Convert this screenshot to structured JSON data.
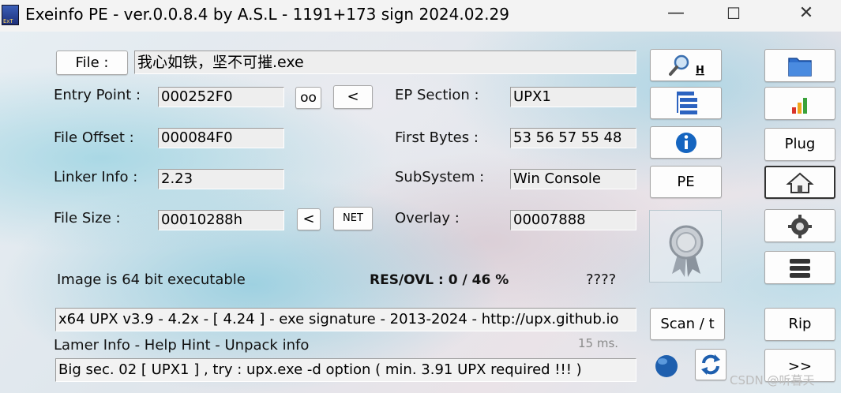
{
  "titlebar": {
    "title": "Exeinfo PE - ver.0.0.8.4  by A.S.L -  1191+173 sign  2024.02.29",
    "minimize_glyph": "—",
    "maximize_glyph": "☐",
    "close_glyph": "✕"
  },
  "file": {
    "button_label": "File :",
    "name": "我心如铁，坚不可摧.exe"
  },
  "fields": {
    "entry_point_label": "Entry Point :",
    "entry_point_value": "000252F0",
    "file_offset_label": "File Offset :",
    "file_offset_value": "000084F0",
    "linker_info_label": "Linker Info :",
    "linker_info_value": "2.23",
    "file_size_label": "File Size :",
    "file_size_value": "00010288h",
    "ep_section_label": "EP Section :",
    "ep_section_value": "UPX1",
    "first_bytes_label": "First Bytes :",
    "first_bytes_value": "53 56 57 55 48",
    "subsystem_label": "SubSystem :",
    "subsystem_value": "Win Console",
    "overlay_label": "Overlay :",
    "overlay_value": "00007888"
  },
  "small_buttons": {
    "oo": "oo",
    "lt1": "<",
    "lt2": "<",
    "net": "NET"
  },
  "status": {
    "bits": "Image is 64 bit executable",
    "res_ovl": "RES/OVL : 0 / 46 %",
    "unknown": "????",
    "detection": "x64 UPX v3.9 - 4.2x - [ 4.24 ] - exe signature - 2013-2024 - http://upx.github.io",
    "lamer_info": "Lamer Info - Help Hint - Unpack info",
    "time": "15 ms.",
    "hint": "Big sec. 02 [ UPX1 ] , try : upx.exe -d option ( min. 3.91 UPX required !!! )"
  },
  "mid_buttons": {
    "search_h": "H",
    "pe": "PE",
    "scan": "Scan / t"
  },
  "right_buttons": {
    "plug": "Plug",
    "rip": "Rip",
    "more": ">>"
  },
  "watermark": "CSDN @听暮天",
  "colors": {
    "accent_blue": "#1f5fbf",
    "bars": [
      "#d9342b",
      "#f0a51b",
      "#3aa23a"
    ]
  }
}
